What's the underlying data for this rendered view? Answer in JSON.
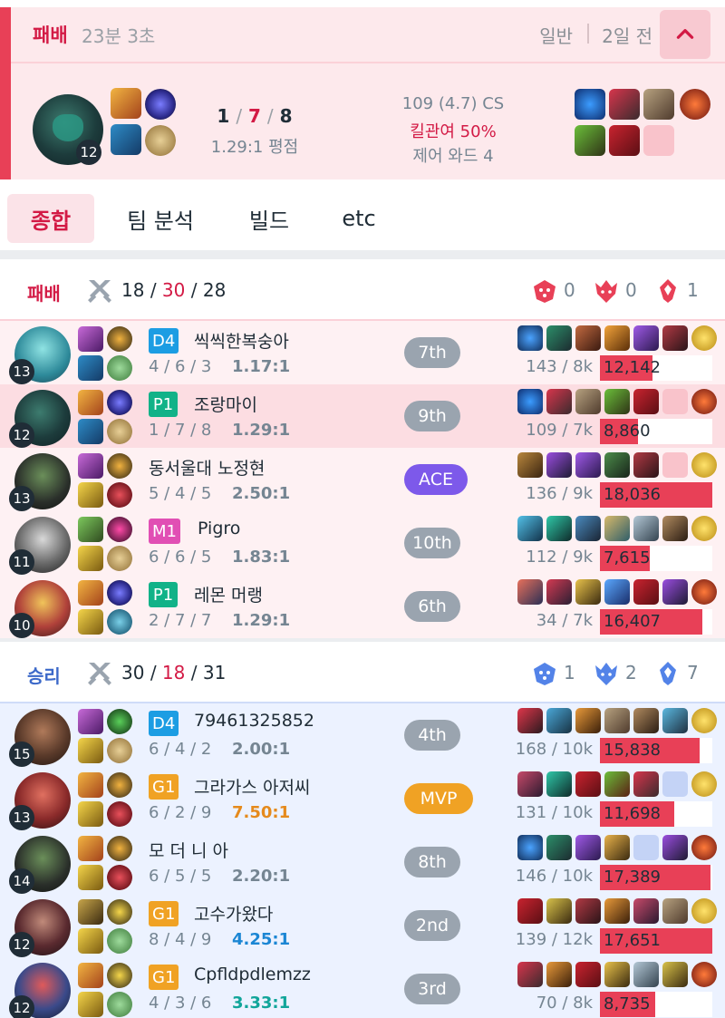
{
  "match": {
    "result": "패배",
    "duration": "23분 3초",
    "queue": "일반",
    "time_ago": "2일 전",
    "level": "12",
    "kills": "1",
    "deaths": "7",
    "assists": "8",
    "slash": "/",
    "ratio": "1.29:1 평점",
    "cs": "109 (4.7) CS",
    "kill_participation": "킬관여 50%",
    "control_wards": "제어 와드 4"
  },
  "tabs": [
    "종합",
    "팀 분석",
    "빌드",
    "etc"
  ],
  "colors": {
    "loss": "#e84057",
    "win": "#5383e8",
    "ace": "#7d59ea",
    "mvp": "#f0a224",
    "teal_tier": "#11b288",
    "gold_tier": "#f0a224",
    "pink_tier": "#e14fb4",
    "blue_tier": "#1c9de3"
  },
  "loss_team": {
    "label": "패배",
    "kills": "18",
    "deaths": "30",
    "assists": "28",
    "objectives": [
      {
        "icon": "baron-icon",
        "value": "0"
      },
      {
        "icon": "dragon-icon",
        "value": "0"
      },
      {
        "icon": "tower-icon",
        "value": "1"
      }
    ],
    "players": [
      {
        "level": "13",
        "tier": "D4",
        "name": "씩씩한복숭아",
        "kda": "4 / 6 / 3",
        "ratio": "1.17:1",
        "rank": "7th",
        "cs": "143 / 8k",
        "damage": "12,142",
        "damage_frac": 0.47
      },
      {
        "level": "12",
        "tier": "P1",
        "name": "조랑마이",
        "kda": "1 / 7 / 8",
        "ratio": "1.29:1",
        "rank": "9th",
        "cs": "109 / 7k",
        "damage": "8,860",
        "damage_frac": 0.34
      },
      {
        "level": "13",
        "tier": "",
        "name": "동서울대 노정현",
        "kda": "5 / 4 / 5",
        "ratio": "2.50:1",
        "rank": "ACE",
        "cs": "136 / 9k",
        "damage": "18,036",
        "damage_frac": 1.0
      },
      {
        "level": "11",
        "tier": "M1",
        "name": "Pigro",
        "kda": "6 / 6 / 5",
        "ratio": "1.83:1",
        "rank": "10th",
        "cs": "112 / 9k",
        "damage": "7,615",
        "damage_frac": 0.44
      },
      {
        "level": "10",
        "tier": "P1",
        "name": "레몬 머랭",
        "kda": "2 / 7 / 7",
        "ratio": "1.29:1",
        "rank": "6th",
        "cs": "34 / 7k",
        "damage": "16,407",
        "damage_frac": 0.91
      }
    ]
  },
  "win_team": {
    "label": "승리",
    "kills": "30",
    "deaths": "18",
    "assists": "31",
    "objectives": [
      {
        "icon": "baron-icon",
        "value": "1"
      },
      {
        "icon": "dragon-icon",
        "value": "2"
      },
      {
        "icon": "tower-icon",
        "value": "7"
      }
    ],
    "players": [
      {
        "level": "15",
        "tier": "D4",
        "name": "79461325852",
        "kda": "6 / 4 / 2",
        "ratio": "2.00:1",
        "rank": "4th",
        "cs": "168 / 10k",
        "damage": "15,838",
        "damage_frac": 0.89
      },
      {
        "level": "13",
        "tier": "G1",
        "name": "그라가스 아저씨",
        "kda": "6 / 2 / 9",
        "ratio": "7.50:1",
        "rank": "MVP",
        "cs": "131 / 10k",
        "damage": "11,698",
        "damage_frac": 0.66
      },
      {
        "level": "14",
        "tier": "",
        "name": "모 더 니 아",
        "kda": "6 / 5 / 5",
        "ratio": "2.20:1",
        "rank": "8th",
        "cs": "146 / 10k",
        "damage": "17,389",
        "damage_frac": 0.98
      },
      {
        "level": "12",
        "tier": "G1",
        "name": "고수가왔다",
        "kda": "8 / 4 / 9",
        "ratio": "4.25:1",
        "rank": "2nd",
        "cs": "139 / 12k",
        "damage": "17,651",
        "damage_frac": 1.0
      },
      {
        "level": "12",
        "tier": "G1",
        "name": "Cpfldpdlemzz",
        "kda": "4 / 3 / 6",
        "ratio": "3.33:1",
        "rank": "3rd",
        "cs": "70 / 8k",
        "damage": "8,735",
        "damage_frac": 0.49
      }
    ]
  }
}
